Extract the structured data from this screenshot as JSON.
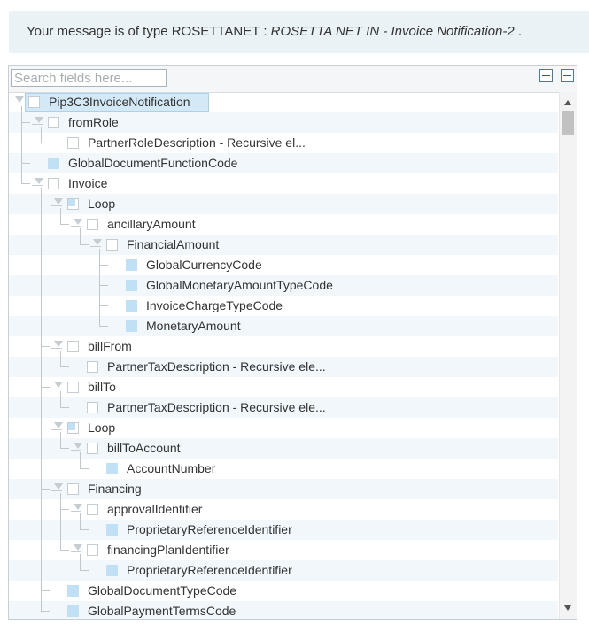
{
  "banner": {
    "prefix": "Your message is of type ROSETTANET : ",
    "message_name": "ROSETTA NET IN - Invoice Notification-2",
    "suffix": " ."
  },
  "search": {
    "placeholder": "Search fields here..."
  },
  "toolbar": {
    "expand_all_icon": "plus-box-icon",
    "collapse_all_icon": "minus-box-icon"
  },
  "tree": {
    "rows": [
      {
        "label": "Pip3C3InvoiceNotification",
        "depth": 0,
        "expandable": true,
        "box": "empty",
        "selected": true
      },
      {
        "label": "fromRole",
        "depth": 1,
        "expandable": true,
        "box": "empty"
      },
      {
        "label": "PartnerRoleDescription - Recursive el...",
        "depth": 2,
        "expandable": false,
        "box": "empty"
      },
      {
        "label": "GlobalDocumentFunctionCode",
        "depth": 1,
        "expandable": false,
        "box": "filled"
      },
      {
        "label": "Invoice",
        "depth": 1,
        "expandable": true,
        "box": "empty"
      },
      {
        "label": "Loop",
        "depth": 2,
        "expandable": true,
        "box": "partial"
      },
      {
        "label": "ancillaryAmount",
        "depth": 3,
        "expandable": true,
        "box": "empty"
      },
      {
        "label": "FinancialAmount",
        "depth": 4,
        "expandable": true,
        "box": "empty"
      },
      {
        "label": "GlobalCurrencyCode",
        "depth": 5,
        "expandable": false,
        "box": "filled"
      },
      {
        "label": "GlobalMonetaryAmountTypeCode",
        "depth": 5,
        "expandable": false,
        "box": "filled"
      },
      {
        "label": "InvoiceChargeTypeCode",
        "depth": 5,
        "expandable": false,
        "box": "filled"
      },
      {
        "label": "MonetaryAmount",
        "depth": 5,
        "expandable": false,
        "box": "filled"
      },
      {
        "label": "billFrom",
        "depth": 2,
        "expandable": true,
        "box": "empty"
      },
      {
        "label": "PartnerTaxDescription - Recursive ele...",
        "depth": 3,
        "expandable": false,
        "box": "empty"
      },
      {
        "label": "billTo",
        "depth": 2,
        "expandable": true,
        "box": "empty"
      },
      {
        "label": "PartnerTaxDescription - Recursive ele...",
        "depth": 3,
        "expandable": false,
        "box": "empty"
      },
      {
        "label": "Loop",
        "depth": 2,
        "expandable": true,
        "box": "partial"
      },
      {
        "label": "billToAccount",
        "depth": 3,
        "expandable": true,
        "box": "empty"
      },
      {
        "label": "AccountNumber",
        "depth": 4,
        "expandable": false,
        "box": "filled"
      },
      {
        "label": "Financing",
        "depth": 2,
        "expandable": true,
        "box": "empty"
      },
      {
        "label": "approvalIdentifier",
        "depth": 3,
        "expandable": true,
        "box": "empty"
      },
      {
        "label": "ProprietaryReferenceIdentifier",
        "depth": 4,
        "expandable": false,
        "box": "filled"
      },
      {
        "label": "financingPlanIdentifier",
        "depth": 3,
        "expandable": true,
        "box": "empty"
      },
      {
        "label": "ProprietaryReferenceIdentifier",
        "depth": 4,
        "expandable": false,
        "box": "filled"
      },
      {
        "label": "GlobalDocumentTypeCode",
        "depth": 2,
        "expandable": false,
        "box": "filled"
      },
      {
        "label": "GlobalPaymentTermsCode",
        "depth": 2,
        "expandable": false,
        "box": "filled"
      }
    ]
  }
}
